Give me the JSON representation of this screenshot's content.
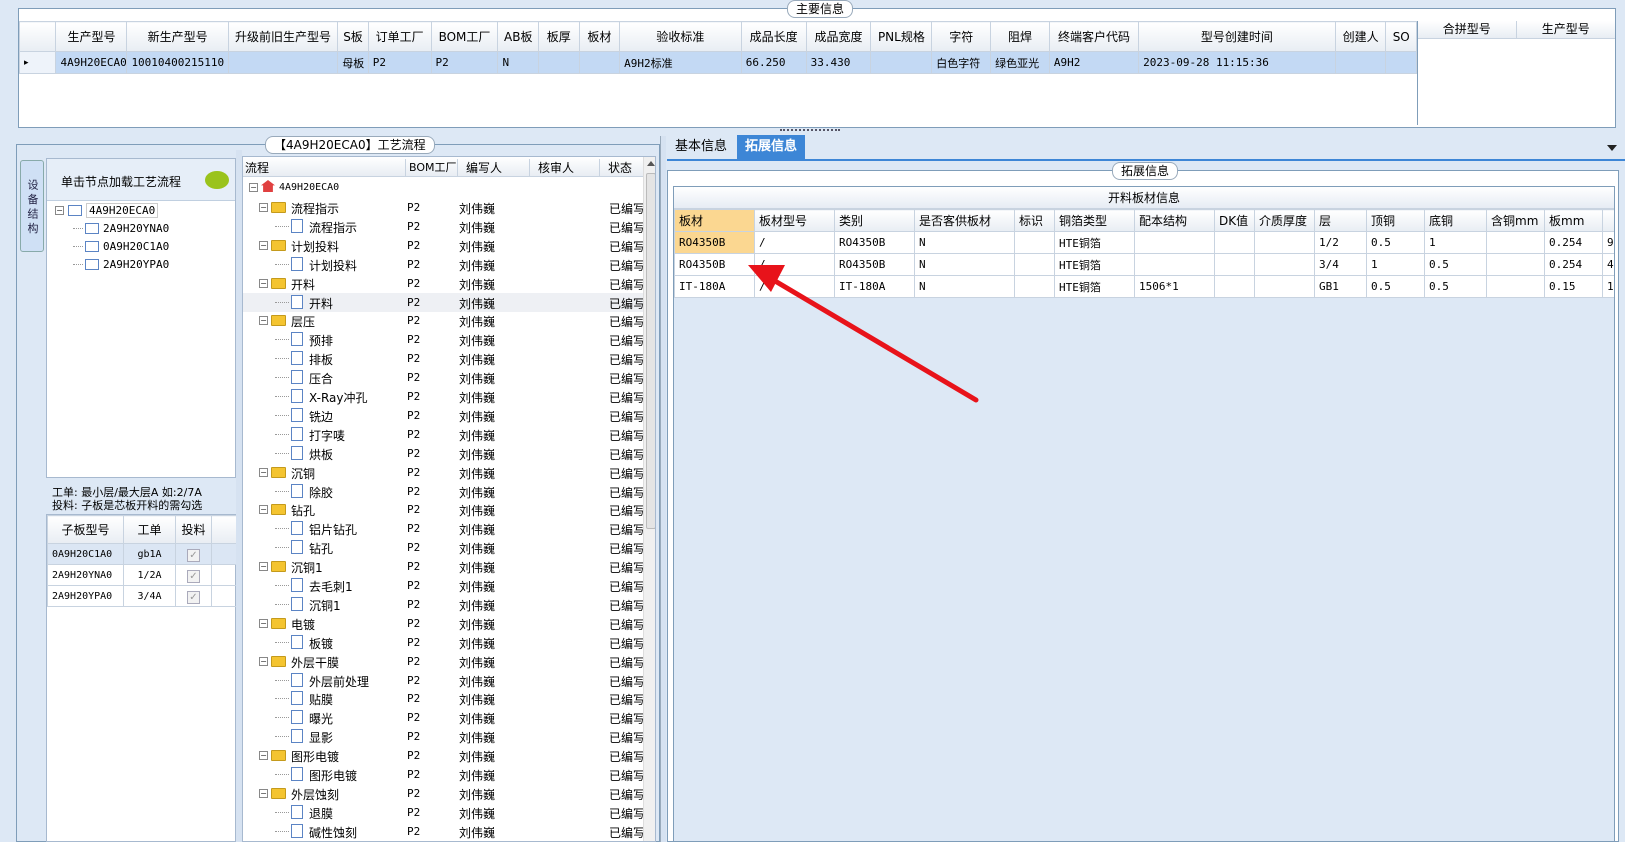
{
  "main_info": {
    "title": "主要信息",
    "columns": [
      "生产型号",
      "新生产型号",
      "升级前旧生产型号",
      "S板",
      "订单工厂",
      "BOM工厂",
      "AB板",
      "板厚",
      "板材",
      "验收标准",
      "成品长度",
      "成品宽度",
      "PNL规格",
      "字符",
      "阻焊",
      "终端客户代码",
      "型号创建时间",
      "创建人",
      "SO"
    ],
    "row": [
      "4A9H20ECA0",
      "10010400215110",
      "",
      "母板",
      "P2",
      "P2",
      "N",
      "",
      "",
      "A9H2标准",
      "66.250",
      "33.430",
      "",
      "白色字符",
      "绿色亚光",
      "A9H2",
      "2023-09-28 11:15:36",
      "",
      ""
    ],
    "right_columns": [
      "合拼型号",
      "生产型号"
    ]
  },
  "process": {
    "title": "【4A9H20ECA0】工艺流程",
    "side_tab": "设 备 结 构",
    "tree_header": "单击节点加载工艺流程",
    "tree": [
      "4A9H20ECA0",
      "2A9H20YNA0",
      "0A9H20C1A0",
      "2A9H20YPA0"
    ],
    "hint1": "工单: 最小层/最大层A 如:2/7A",
    "hint2": "投料: 子板是芯板开料的需勾选",
    "sub_columns": [
      "子板型号",
      "工单",
      "投料"
    ],
    "sub_rows": [
      {
        "model": "0A9H20C1A0",
        "order": "gb1A"
      },
      {
        "model": "2A9H20YNA0",
        "order": "1/2A"
      },
      {
        "model": "2A9H20YPA0",
        "order": "3/4A"
      }
    ],
    "flow_columns": [
      "流程",
      "BOM工厂",
      "编写人",
      "核审人",
      "状态"
    ],
    "flow_root": "4A9H20ECA0",
    "flow_rows": [
      {
        "name": "流程指示",
        "level": 1,
        "bom": "P2",
        "writer": "刘伟巍",
        "status": "已编写"
      },
      {
        "name": "流程指示",
        "level": 2,
        "bom": "P2",
        "writer": "刘伟巍",
        "status": "已编写"
      },
      {
        "name": "计划投料",
        "level": 1,
        "bom": "P2",
        "writer": "刘伟巍",
        "status": "已编写"
      },
      {
        "name": "计划投料",
        "level": 2,
        "bom": "P2",
        "writer": "刘伟巍",
        "status": "已编写"
      },
      {
        "name": "开料",
        "level": 1,
        "bom": "P2",
        "writer": "刘伟巍",
        "status": "已编写"
      },
      {
        "name": "开料",
        "level": 2,
        "bom": "P2",
        "writer": "刘伟巍",
        "status": "已编写"
      },
      {
        "name": "层压",
        "level": 1,
        "bom": "P2",
        "writer": "刘伟巍",
        "status": "已编写"
      },
      {
        "name": "预排",
        "level": 2,
        "bom": "P2",
        "writer": "刘伟巍",
        "status": "已编写"
      },
      {
        "name": "排板",
        "level": 2,
        "bom": "P2",
        "writer": "刘伟巍",
        "status": "已编写"
      },
      {
        "name": "压合",
        "level": 2,
        "bom": "P2",
        "writer": "刘伟巍",
        "status": "已编写"
      },
      {
        "name": "X-Ray冲孔",
        "level": 2,
        "bom": "P2",
        "writer": "刘伟巍",
        "status": "已编写"
      },
      {
        "name": "铣边",
        "level": 2,
        "bom": "P2",
        "writer": "刘伟巍",
        "status": "已编写"
      },
      {
        "name": "打字唛",
        "level": 2,
        "bom": "P2",
        "writer": "刘伟巍",
        "status": "已编写"
      },
      {
        "name": "烘板",
        "level": 2,
        "bom": "P2",
        "writer": "刘伟巍",
        "status": "已编写"
      },
      {
        "name": "沉铜",
        "level": 1,
        "bom": "P2",
        "writer": "刘伟巍",
        "status": "已编写"
      },
      {
        "name": "除胶",
        "level": 2,
        "bom": "P2",
        "writer": "刘伟巍",
        "status": "已编写"
      },
      {
        "name": "钻孔",
        "level": 1,
        "bom": "P2",
        "writer": "刘伟巍",
        "status": "已编写"
      },
      {
        "name": "铝片钻孔",
        "level": 2,
        "bom": "P2",
        "writer": "刘伟巍",
        "status": "已编写"
      },
      {
        "name": "钻孔",
        "level": 2,
        "bom": "P2",
        "writer": "刘伟巍",
        "status": "已编写"
      },
      {
        "name": "沉铜1",
        "level": 1,
        "bom": "P2",
        "writer": "刘伟巍",
        "status": "已编写"
      },
      {
        "name": "去毛刺1",
        "level": 2,
        "bom": "P2",
        "writer": "刘伟巍",
        "status": "已编写"
      },
      {
        "name": "沉铜1",
        "level": 2,
        "bom": "P2",
        "writer": "刘伟巍",
        "status": "已编写"
      },
      {
        "name": "电镀",
        "level": 1,
        "bom": "P2",
        "writer": "刘伟巍",
        "status": "已编写"
      },
      {
        "name": "板镀",
        "level": 2,
        "bom": "P2",
        "writer": "刘伟巍",
        "status": "已编写"
      },
      {
        "name": "外层干膜",
        "level": 1,
        "bom": "P2",
        "writer": "刘伟巍",
        "status": "已编写"
      },
      {
        "name": "外层前处理",
        "level": 2,
        "bom": "P2",
        "writer": "刘伟巍",
        "status": "已编写"
      },
      {
        "name": "贴膜",
        "level": 2,
        "bom": "P2",
        "writer": "刘伟巍",
        "status": "已编写"
      },
      {
        "name": "曝光",
        "level": 2,
        "bom": "P2",
        "writer": "刘伟巍",
        "status": "已编写"
      },
      {
        "name": "显影",
        "level": 2,
        "bom": "P2",
        "writer": "刘伟巍",
        "status": "已编写"
      },
      {
        "name": "图形电镀",
        "level": 1,
        "bom": "P2",
        "writer": "刘伟巍",
        "status": "已编写"
      },
      {
        "name": "图形电镀",
        "level": 2,
        "bom": "P2",
        "writer": "刘伟巍",
        "status": "已编写"
      },
      {
        "name": "外层蚀刻",
        "level": 1,
        "bom": "P2",
        "writer": "刘伟巍",
        "status": "已编写"
      },
      {
        "name": "退膜",
        "level": 2,
        "bom": "P2",
        "writer": "刘伟巍",
        "status": "已编写"
      },
      {
        "name": "碱性蚀刻",
        "level": 2,
        "bom": "P2",
        "writer": "刘伟巍",
        "status": "已编写"
      }
    ]
  },
  "right": {
    "tabs": [
      "基本信息",
      "拓展信息"
    ],
    "ext_title": "拓展信息",
    "material_title": "开料板材信息",
    "material_columns": [
      "板材",
      "板材型号",
      "类别",
      "是否客供板材",
      "标识",
      "铜箔类型",
      "配本结构",
      "DK值",
      "介质厚度",
      "层",
      "顶铜",
      "底铜",
      "含铜mm",
      "板mm",
      ""
    ],
    "material_rows": [
      [
        "RO4350B",
        "/",
        "RO4350B",
        "N",
        "",
        "HTE铜箔",
        "",
        "",
        "",
        "1/2",
        "0.5",
        "1",
        "",
        "0.254",
        "9"
      ],
      [
        "RO4350B",
        "/",
        "RO4350B",
        "N",
        "",
        "HTE铜箔",
        "",
        "",
        "",
        "3/4",
        "1",
        "0.5",
        "",
        "0.254",
        "4"
      ],
      [
        "IT-180A",
        "/",
        "IT-180A",
        "N",
        "",
        "HTE铜箔",
        "1506*1",
        "",
        "",
        "GB1",
        "0.5",
        "0.5",
        "",
        "0.15",
        "1"
      ]
    ]
  },
  "colors": {
    "accent": "#3d86d6",
    "selected": "#c3d9f4",
    "highlight": "#fbd791",
    "arrow": "#e8131a"
  }
}
